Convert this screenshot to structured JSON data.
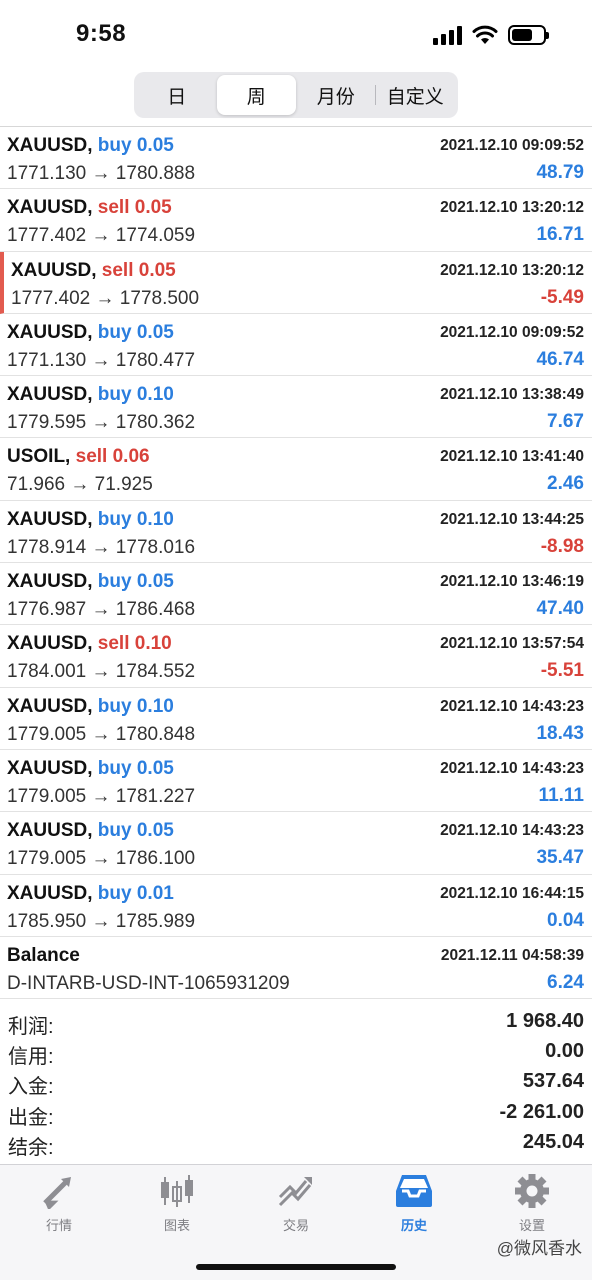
{
  "status_bar": {
    "time": "9:58"
  },
  "segment": {
    "tabs": [
      "日",
      "周",
      "月份",
      "自定义"
    ],
    "active_index": 1
  },
  "trades": [
    {
      "symbol": "XAUUSD,",
      "side": "buy 0.05",
      "type": "buy",
      "datetime": "2021.12.10 09:09:52",
      "price": "1771.130 → 1780.888",
      "profit": "48.79",
      "profit_sign": "pos"
    },
    {
      "symbol": "XAUUSD,",
      "side": "sell 0.05",
      "type": "sell",
      "datetime": "2021.12.10 13:20:12",
      "price": "1777.402 → 1774.059",
      "profit": "16.71",
      "profit_sign": "pos"
    },
    {
      "symbol": "XAUUSD,",
      "side": "sell 0.05",
      "type": "sell",
      "datetime": "2021.12.10 13:20:12",
      "price": "1777.402 → 1778.500",
      "profit": "-5.49",
      "profit_sign": "neg",
      "flag": true
    },
    {
      "symbol": "XAUUSD,",
      "side": "buy 0.05",
      "type": "buy",
      "datetime": "2021.12.10 09:09:52",
      "price": "1771.130 → 1780.477",
      "profit": "46.74",
      "profit_sign": "pos"
    },
    {
      "symbol": "XAUUSD,",
      "side": "buy 0.10",
      "type": "buy",
      "datetime": "2021.12.10 13:38:49",
      "price": "1779.595 → 1780.362",
      "profit": "7.67",
      "profit_sign": "pos"
    },
    {
      "symbol": "USOIL,",
      "side": "sell 0.06",
      "type": "sell",
      "datetime": "2021.12.10 13:41:40",
      "price": "71.966 → 71.925",
      "profit": "2.46",
      "profit_sign": "pos"
    },
    {
      "symbol": "XAUUSD,",
      "side": "buy 0.10",
      "type": "buy",
      "datetime": "2021.12.10 13:44:25",
      "price": "1778.914 → 1778.016",
      "profit": "-8.98",
      "profit_sign": "neg"
    },
    {
      "symbol": "XAUUSD,",
      "side": "buy 0.05",
      "type": "buy",
      "datetime": "2021.12.10 13:46:19",
      "price": "1776.987 → 1786.468",
      "profit": "47.40",
      "profit_sign": "pos"
    },
    {
      "symbol": "XAUUSD,",
      "side": "sell 0.10",
      "type": "sell",
      "datetime": "2021.12.10 13:57:54",
      "price": "1784.001 → 1784.552",
      "profit": "-5.51",
      "profit_sign": "neg"
    },
    {
      "symbol": "XAUUSD,",
      "side": "buy 0.10",
      "type": "buy",
      "datetime": "2021.12.10 14:43:23",
      "price": "1779.005 → 1780.848",
      "profit": "18.43",
      "profit_sign": "pos"
    },
    {
      "symbol": "XAUUSD,",
      "side": "buy 0.05",
      "type": "buy",
      "datetime": "2021.12.10 14:43:23",
      "price": "1779.005 → 1781.227",
      "profit": "11.11",
      "profit_sign": "pos"
    },
    {
      "symbol": "XAUUSD,",
      "side": "buy 0.05",
      "type": "buy",
      "datetime": "2021.12.10 14:43:23",
      "price": "1779.005 → 1786.100",
      "profit": "35.47",
      "profit_sign": "pos"
    },
    {
      "symbol": "XAUUSD,",
      "side": "buy 0.01",
      "type": "buy",
      "datetime": "2021.12.10 16:44:15",
      "price": "1785.950 → 1785.989",
      "profit": "0.04",
      "profit_sign": "pos"
    },
    {
      "symbol": "Balance",
      "side": "",
      "type": "balance",
      "datetime": "2021.12.11 04:58:39",
      "price": "D-INTARB-USD-INT-1065931209",
      "profit": "6.24",
      "profit_sign": "pos"
    }
  ],
  "summary": [
    {
      "label": "利润:",
      "value": "1 968.40"
    },
    {
      "label": "信用:",
      "value": "0.00"
    },
    {
      "label": "入金:",
      "value": "537.64"
    },
    {
      "label": "出金:",
      "value": "-2 261.00"
    },
    {
      "label": "结余:",
      "value": "245.04"
    }
  ],
  "tabbar": {
    "tabs": [
      {
        "label": "行情",
        "icon": "quotes-arrows-icon"
      },
      {
        "label": "图表",
        "icon": "candlestick-chart-icon"
      },
      {
        "label": "交易",
        "icon": "trade-trend-icon"
      },
      {
        "label": "历史",
        "icon": "history-inbox-icon"
      },
      {
        "label": "设置",
        "icon": "gear-icon"
      }
    ],
    "active_index": 3
  },
  "watermark": "@微风香水",
  "colors": {
    "buy": "#2b7ede",
    "sell": "#d8423a",
    "accent": "#2b7ede"
  }
}
